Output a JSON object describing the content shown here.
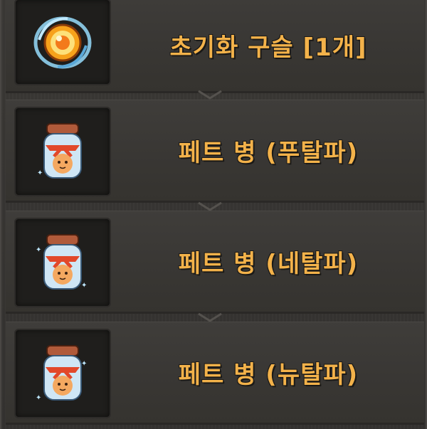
{
  "rewards": [
    {
      "label": "초기화 구슬 [1개]",
      "icon": "reset-orb-icon"
    },
    {
      "label": "페트 병 (푸탈파)",
      "icon": "pet-jar-icon"
    },
    {
      "label": "페트 병 (네탈파)",
      "icon": "pet-jar-icon"
    },
    {
      "label": "페트 병 (뉴탈파)",
      "icon": "pet-jar-icon"
    }
  ],
  "colors": {
    "label_text": "#f3b24a",
    "panel_bg": "#3a3835",
    "icon_bg": "#1f1e1c"
  }
}
